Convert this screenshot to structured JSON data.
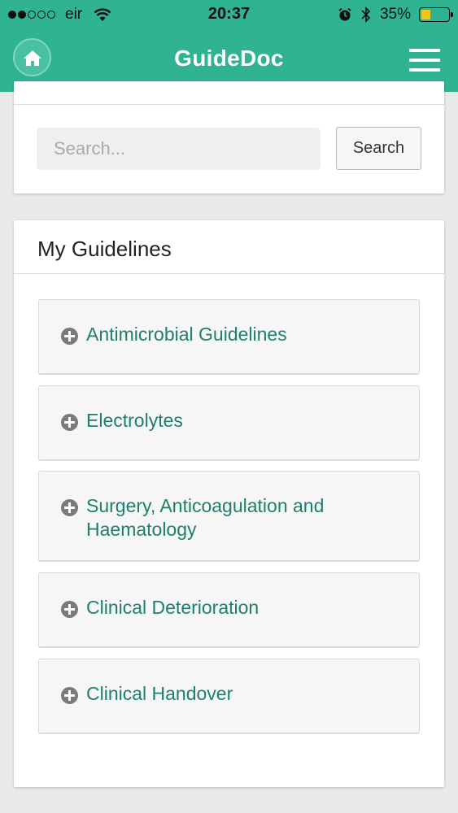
{
  "status_bar": {
    "carrier": "eir",
    "time": "20:37",
    "battery_percent": "35%",
    "battery_level": 0.35,
    "signal_bars_filled": 2,
    "signal_bars_total": 5
  },
  "header": {
    "title": "GuideDoc",
    "home_icon": "home-icon",
    "menu_icon": "hamburger-menu-icon",
    "color": "#2fb392"
  },
  "search": {
    "placeholder": "Search...",
    "value": "",
    "button_label": "Search"
  },
  "guidelines": {
    "title": "My Guidelines",
    "items": [
      {
        "label": "Antimicrobial Guidelines",
        "icon": "plus-circle-icon"
      },
      {
        "label": "Electrolytes",
        "icon": "plus-circle-icon"
      },
      {
        "label": "Surgery, Anticoagulation and Haematology",
        "icon": "plus-circle-icon"
      },
      {
        "label": "Clinical Deterioration",
        "icon": "plus-circle-icon"
      },
      {
        "label": "Clinical Handover",
        "icon": "plus-circle-icon"
      }
    ]
  },
  "colors": {
    "accent": "#2fb392",
    "link_text": "#1d7f6c",
    "battery_fill": "#f5c518"
  }
}
